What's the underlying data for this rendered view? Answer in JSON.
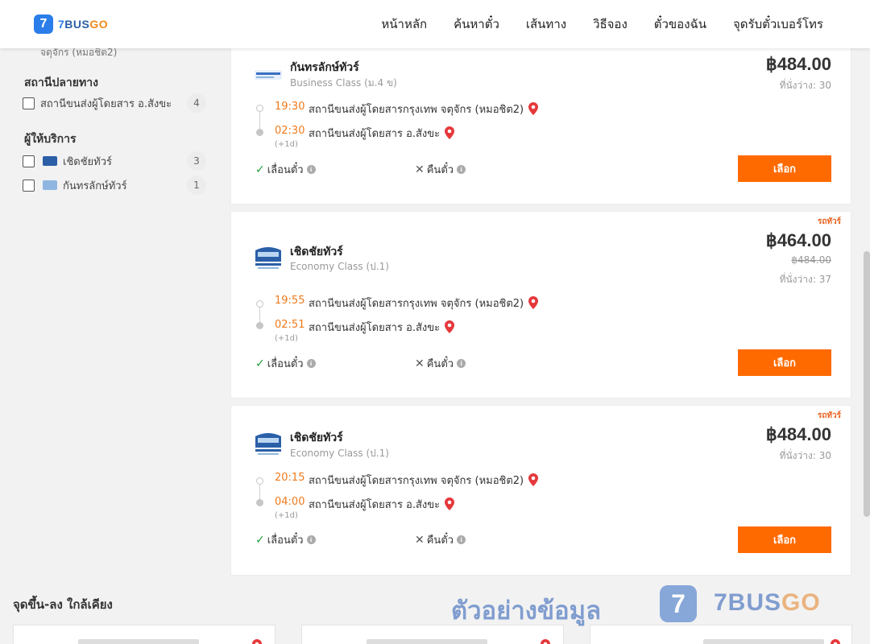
{
  "header": {
    "logo": {
      "mark": "7",
      "seven": "7",
      "bus": "BUS",
      "go": "GO"
    },
    "nav": [
      "หน้าหลัก",
      "ค้นหาตั๋ว",
      "เส้นทาง",
      "วิธีจอง",
      "ตั๋วของฉัน",
      "จุดรับตั๋วเบอร์โทร"
    ]
  },
  "sidebar": {
    "cut_text": "จตุจักร (หมอชิต2)",
    "destination": {
      "title": "สถานีปลายทาง",
      "items": [
        {
          "label": "สถานีขนส่งผู้โดยสาร อ.สังขะ",
          "count": "4"
        }
      ]
    },
    "operators": {
      "title": "ผู้ให้บริการ",
      "items": [
        {
          "label": "เชิดชัยทัวร์",
          "count": "3",
          "logo_color": "#2b5fa8"
        },
        {
          "label": "กันทรลักษ์ทัวร์",
          "count": "1",
          "logo_color": "#8fb6e0"
        }
      ]
    }
  },
  "trips": [
    {
      "operator": "กันทรลักษ์ทัวร์",
      "class": "Business Class (ม.4 ข)",
      "icon": "kantharalak-logo",
      "depart_time": "19:30",
      "depart_station": "สถานีขนส่งผู้โดยสารกรุงเทพ จตุจักร (หมอชิต2)",
      "arrive_time": "02:30",
      "arrive_station": "สถานีขนส่งผู้โดยสาร อ.สังขะ",
      "next_day": "(+1d)",
      "postpone": "เลื่อนตั๋ว",
      "refund": "คืนตั๋ว",
      "tag": "",
      "price": "฿484.00",
      "old_price": "",
      "seats": "ที่นั่งว่าง: 30",
      "button": "เลือก"
    },
    {
      "operator": "เชิดชัยทัวร์",
      "class": "Economy Class (ป.1)",
      "icon": "cherdchai-bus-logo",
      "depart_time": "19:55",
      "depart_station": "สถานีขนส่งผู้โดยสารกรุงเทพ จตุจักร (หมอชิต2)",
      "arrive_time": "02:51",
      "arrive_station": "สถานีขนส่งผู้โดยสาร อ.สังขะ",
      "next_day": "(+1d)",
      "postpone": "เลื่อนตั๋ว",
      "refund": "คืนตั๋ว",
      "tag": "รถทัวร์",
      "price": "฿464.00",
      "old_price": "฿484.00",
      "seats": "ที่นั่งว่าง: 37",
      "button": "เลือก"
    },
    {
      "operator": "เชิดชัยทัวร์",
      "class": "Economy Class (ป.1)",
      "icon": "cherdchai-bus-logo",
      "depart_time": "20:15",
      "depart_station": "สถานีขนส่งผู้โดยสารกรุงเทพ จตุจักร (หมอชิต2)",
      "arrive_time": "04:00",
      "arrive_station": "สถานีขนส่งผู้โดยสาร อ.สังขะ",
      "next_day": "(+1d)",
      "postpone": "เลื่อนตั๋ว",
      "refund": "คืนตั๋ว",
      "tag": "รถทัวร์",
      "price": "฿484.00",
      "old_price": "",
      "seats": "ที่นั่งว่าง: 30",
      "button": "เลือก"
    }
  ],
  "nearby": {
    "title": "จุดขึ้น-ลง ใกล้เคียง"
  },
  "watermark": {
    "text": "ตัวอย่างข้อมูล",
    "mark": "7",
    "bus": "7BUS",
    "go": "GO"
  },
  "colors": {
    "accent": "#ff6a00",
    "time": "#f07a1b",
    "brand_blue": "#2b7de9",
    "ok": "#1f9d3c",
    "pin": "#e5383b"
  }
}
